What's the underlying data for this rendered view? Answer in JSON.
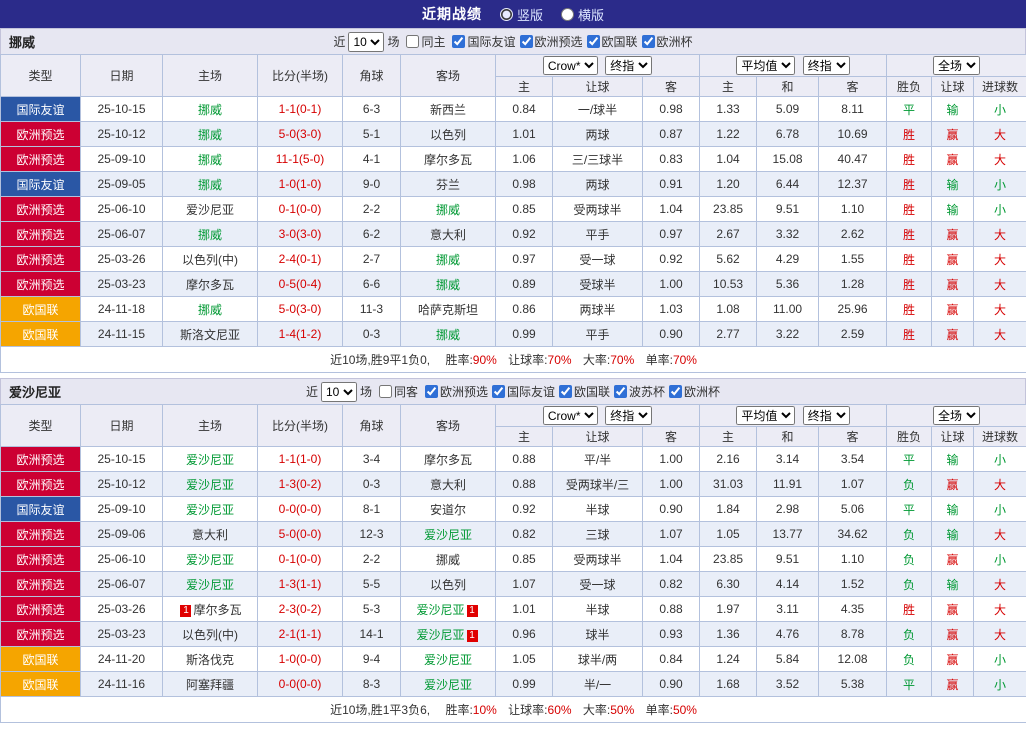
{
  "header": {
    "title": "近期战绩",
    "view_options": [
      {
        "label": "竖版",
        "selected": true
      },
      {
        "label": "横版",
        "selected": false
      }
    ]
  },
  "colors": {
    "topbar_bg": "#2b2b8a",
    "badge_friendly_blue": "#2a57a5",
    "badge_qualifier_red": "#cc0033",
    "badge_nations_orange": "#f5a500",
    "win_red": "#d60000",
    "lose_green": "#009933",
    "focus_team_green": "#009933"
  },
  "table_head": {
    "type": "类型",
    "date": "日期",
    "home": "主场",
    "score": "比分(半场)",
    "corner": "角球",
    "away": "客场",
    "odds_home": "主",
    "odds_handicap": "让球",
    "odds_away": "客",
    "avg_home": "主",
    "avg_draw": "和",
    "avg_away": "客",
    "result": "胜负",
    "handicap_result": "让球",
    "goals": "进球数",
    "dd_odds_source": "Crow*",
    "dd_final_odds": "终指",
    "dd_average": "平均值",
    "dd_final_odds2": "终指",
    "dd_scope": "全场"
  },
  "sections": [
    {
      "team": "挪威",
      "filter": {
        "near": "近",
        "count": "10",
        "games": "场",
        "same": {
          "label": "同主",
          "checked": false
        },
        "competitions": [
          {
            "label": "国际友谊",
            "checked": true
          },
          {
            "label": "欧洲预选",
            "checked": true
          },
          {
            "label": "欧国联",
            "checked": true
          },
          {
            "label": "欧洲杯",
            "checked": true
          }
        ]
      },
      "rows": [
        {
          "type": "国际友谊",
          "type_key": "friendly",
          "date": "25-10-15",
          "home": "挪威",
          "home_focus": true,
          "home_card": "",
          "score": "1-1(0-1)",
          "corner": "6-3",
          "away": "新西兰",
          "away_focus": false,
          "away_card": "",
          "odds_home": "0.84",
          "handicap": "一/球半",
          "odds_away": "0.98",
          "avg_home": "1.33",
          "avg_draw": "5.09",
          "avg_away": "8.11",
          "result": "平",
          "result_red": false,
          "handicap_result": "输",
          "handicap_red": false,
          "goals": "小",
          "goals_red": false
        },
        {
          "type": "欧洲预选",
          "type_key": "qualifier",
          "date": "25-10-12",
          "home": "挪威",
          "home_focus": true,
          "home_card": "",
          "score": "5-0(3-0)",
          "corner": "5-1",
          "away": "以色列",
          "away_focus": false,
          "away_card": "",
          "odds_home": "1.01",
          "handicap": "两球",
          "odds_away": "0.87",
          "avg_home": "1.22",
          "avg_draw": "6.78",
          "avg_away": "10.69",
          "result": "胜",
          "result_red": true,
          "handicap_result": "赢",
          "handicap_red": true,
          "goals": "大",
          "goals_red": true
        },
        {
          "type": "欧洲预选",
          "type_key": "qualifier",
          "date": "25-09-10",
          "home": "挪威",
          "home_focus": true,
          "home_card": "",
          "score": "11-1(5-0)",
          "corner": "4-1",
          "away": "摩尔多瓦",
          "away_focus": false,
          "away_card": "",
          "odds_home": "1.06",
          "handicap": "三/三球半",
          "odds_away": "0.83",
          "avg_home": "1.04",
          "avg_draw": "15.08",
          "avg_away": "40.47",
          "result": "胜",
          "result_red": true,
          "handicap_result": "赢",
          "handicap_red": true,
          "goals": "大",
          "goals_red": true
        },
        {
          "type": "国际友谊",
          "type_key": "friendly",
          "date": "25-09-05",
          "home": "挪威",
          "home_focus": true,
          "home_card": "",
          "score": "1-0(1-0)",
          "corner": "9-0",
          "away": "芬兰",
          "away_focus": false,
          "away_card": "",
          "odds_home": "0.98",
          "handicap": "两球",
          "odds_away": "0.91",
          "avg_home": "1.20",
          "avg_draw": "6.44",
          "avg_away": "12.37",
          "result": "胜",
          "result_red": true,
          "handicap_result": "输",
          "handicap_red": false,
          "goals": "小",
          "goals_red": false
        },
        {
          "type": "欧洲预选",
          "type_key": "qualifier",
          "date": "25-06-10",
          "home": "爱沙尼亚",
          "home_focus": false,
          "home_card": "",
          "score": "0-1(0-0)",
          "corner": "2-2",
          "away": "挪威",
          "away_focus": true,
          "away_card": "",
          "odds_home": "0.85",
          "handicap": "受两球半",
          "odds_away": "1.04",
          "avg_home": "23.85",
          "avg_draw": "9.51",
          "avg_away": "1.10",
          "result": "胜",
          "result_red": true,
          "handicap_result": "输",
          "handicap_red": false,
          "goals": "小",
          "goals_red": false
        },
        {
          "type": "欧洲预选",
          "type_key": "qualifier",
          "date": "25-06-07",
          "home": "挪威",
          "home_focus": true,
          "home_card": "",
          "score": "3-0(3-0)",
          "corner": "6-2",
          "away": "意大利",
          "away_focus": false,
          "away_card": "",
          "odds_home": "0.92",
          "handicap": "平手",
          "odds_away": "0.97",
          "avg_home": "2.67",
          "avg_draw": "3.32",
          "avg_away": "2.62",
          "result": "胜",
          "result_red": true,
          "handicap_result": "赢",
          "handicap_red": true,
          "goals": "大",
          "goals_red": true
        },
        {
          "type": "欧洲预选",
          "type_key": "qualifier",
          "date": "25-03-26",
          "home": "以色列(中)",
          "home_focus": false,
          "home_card": "",
          "score": "2-4(0-1)",
          "corner": "2-7",
          "away": "挪威",
          "away_focus": true,
          "away_card": "",
          "odds_home": "0.97",
          "handicap": "受一球",
          "odds_away": "0.92",
          "avg_home": "5.62",
          "avg_draw": "4.29",
          "avg_away": "1.55",
          "result": "胜",
          "result_red": true,
          "handicap_result": "赢",
          "handicap_red": true,
          "goals": "大",
          "goals_red": true
        },
        {
          "type": "欧洲预选",
          "type_key": "qualifier",
          "date": "25-03-23",
          "home": "摩尔多瓦",
          "home_focus": false,
          "home_card": "",
          "score": "0-5(0-4)",
          "corner": "6-6",
          "away": "挪威",
          "away_focus": true,
          "away_card": "",
          "odds_home": "0.89",
          "handicap": "受球半",
          "odds_away": "1.00",
          "avg_home": "10.53",
          "avg_draw": "5.36",
          "avg_away": "1.28",
          "result": "胜",
          "result_red": true,
          "handicap_result": "赢",
          "handicap_red": true,
          "goals": "大",
          "goals_red": true
        },
        {
          "type": "欧国联",
          "type_key": "nations",
          "date": "24-11-18",
          "home": "挪威",
          "home_focus": true,
          "home_card": "",
          "score": "5-0(3-0)",
          "corner": "11-3",
          "away": "哈萨克斯坦",
          "away_focus": false,
          "away_card": "",
          "odds_home": "0.86",
          "handicap": "两球半",
          "odds_away": "1.03",
          "avg_home": "1.08",
          "avg_draw": "11.00",
          "avg_away": "25.96",
          "result": "胜",
          "result_red": true,
          "handicap_result": "赢",
          "handicap_red": true,
          "goals": "大",
          "goals_red": true
        },
        {
          "type": "欧国联",
          "type_key": "nations",
          "date": "24-11-15",
          "home": "斯洛文尼亚",
          "home_focus": false,
          "home_card": "",
          "score": "1-4(1-2)",
          "corner": "0-3",
          "away": "挪威",
          "away_focus": true,
          "away_card": "",
          "odds_home": "0.99",
          "handicap": "平手",
          "odds_away": "0.90",
          "avg_home": "2.77",
          "avg_draw": "3.22",
          "avg_away": "2.59",
          "result": "胜",
          "result_red": true,
          "handicap_result": "赢",
          "handicap_red": true,
          "goals": "大",
          "goals_red": true
        }
      ],
      "summary": {
        "prefix": "近10场,胜9平1负0,",
        "stats": [
          {
            "label": "胜率:",
            "value": "90%"
          },
          {
            "label": "让球率:",
            "value": "70%"
          },
          {
            "label": "大率:",
            "value": "70%"
          },
          {
            "label": "单率:",
            "value": "70%"
          }
        ]
      }
    },
    {
      "team": "爱沙尼亚",
      "filter": {
        "near": "近",
        "count": "10",
        "games": "场",
        "same": {
          "label": "同客",
          "checked": false
        },
        "competitions": [
          {
            "label": "欧洲预选",
            "checked": true
          },
          {
            "label": "国际友谊",
            "checked": true
          },
          {
            "label": "欧国联",
            "checked": true
          },
          {
            "label": "波苏杯",
            "checked": true
          },
          {
            "label": "欧洲杯",
            "checked": true
          }
        ]
      },
      "rows": [
        {
          "type": "欧洲预选",
          "type_key": "qualifier",
          "date": "25-10-15",
          "home": "爱沙尼亚",
          "home_focus": true,
          "home_card": "",
          "score": "1-1(1-0)",
          "corner": "3-4",
          "away": "摩尔多瓦",
          "away_focus": false,
          "away_card": "",
          "odds_home": "0.88",
          "handicap": "平/半",
          "odds_away": "1.00",
          "avg_home": "2.16",
          "avg_draw": "3.14",
          "avg_away": "3.54",
          "result": "平",
          "result_red": false,
          "handicap_result": "输",
          "handicap_red": false,
          "goals": "小",
          "goals_red": false
        },
        {
          "type": "欧洲预选",
          "type_key": "qualifier",
          "date": "25-10-12",
          "home": "爱沙尼亚",
          "home_focus": true,
          "home_card": "",
          "score": "1-3(0-2)",
          "corner": "0-3",
          "away": "意大利",
          "away_focus": false,
          "away_card": "",
          "odds_home": "0.88",
          "handicap": "受两球半/三",
          "odds_away": "1.00",
          "avg_home": "31.03",
          "avg_draw": "11.91",
          "avg_away": "1.07",
          "result": "负",
          "result_red": false,
          "handicap_result": "赢",
          "handicap_red": true,
          "goals": "大",
          "goals_red": true
        },
        {
          "type": "国际友谊",
          "type_key": "friendly",
          "date": "25-09-10",
          "home": "爱沙尼亚",
          "home_focus": true,
          "home_card": "",
          "score": "0-0(0-0)",
          "corner": "8-1",
          "away": "安道尔",
          "away_focus": false,
          "away_card": "",
          "odds_home": "0.92",
          "handicap": "半球",
          "odds_away": "0.90",
          "avg_home": "1.84",
          "avg_draw": "2.98",
          "avg_away": "5.06",
          "result": "平",
          "result_red": false,
          "handicap_result": "输",
          "handicap_red": false,
          "goals": "小",
          "goals_red": false
        },
        {
          "type": "欧洲预选",
          "type_key": "qualifier",
          "date": "25-09-06",
          "home": "意大利",
          "home_focus": false,
          "home_card": "",
          "score": "5-0(0-0)",
          "corner": "12-3",
          "away": "爱沙尼亚",
          "away_focus": true,
          "away_card": "",
          "odds_home": "0.82",
          "handicap": "三球",
          "odds_away": "1.07",
          "avg_home": "1.05",
          "avg_draw": "13.77",
          "avg_away": "34.62",
          "result": "负",
          "result_red": false,
          "handicap_result": "输",
          "handicap_red": false,
          "goals": "大",
          "goals_red": true
        },
        {
          "type": "欧洲预选",
          "type_key": "qualifier",
          "date": "25-06-10",
          "home": "爱沙尼亚",
          "home_focus": true,
          "home_card": "",
          "score": "0-1(0-0)",
          "corner": "2-2",
          "away": "挪威",
          "away_focus": false,
          "away_card": "",
          "odds_home": "0.85",
          "handicap": "受两球半",
          "odds_away": "1.04",
          "avg_home": "23.85",
          "avg_draw": "9.51",
          "avg_away": "1.10",
          "result": "负",
          "result_red": false,
          "handicap_result": "赢",
          "handicap_red": true,
          "goals": "小",
          "goals_red": false
        },
        {
          "type": "欧洲预选",
          "type_key": "qualifier",
          "date": "25-06-07",
          "home": "爱沙尼亚",
          "home_focus": true,
          "home_card": "",
          "score": "1-3(1-1)",
          "corner": "5-5",
          "away": "以色列",
          "away_focus": false,
          "away_card": "",
          "odds_home": "1.07",
          "handicap": "受一球",
          "odds_away": "0.82",
          "avg_home": "6.30",
          "avg_draw": "4.14",
          "avg_away": "1.52",
          "result": "负",
          "result_red": false,
          "handicap_result": "输",
          "handicap_red": false,
          "goals": "大",
          "goals_red": true
        },
        {
          "type": "欧洲预选",
          "type_key": "qualifier",
          "date": "25-03-26",
          "home": "摩尔多瓦",
          "home_focus": false,
          "home_card": "1",
          "score": "2-3(0-2)",
          "corner": "5-3",
          "away": "爱沙尼亚",
          "away_focus": true,
          "away_card": "1",
          "odds_home": "1.01",
          "handicap": "半球",
          "odds_away": "0.88",
          "avg_home": "1.97",
          "avg_draw": "3.11",
          "avg_away": "4.35",
          "result": "胜",
          "result_red": true,
          "handicap_result": "赢",
          "handicap_red": true,
          "goals": "大",
          "goals_red": true
        },
        {
          "type": "欧洲预选",
          "type_key": "qualifier",
          "date": "25-03-23",
          "home": "以色列(中)",
          "home_focus": false,
          "home_card": "",
          "score": "2-1(1-1)",
          "corner": "14-1",
          "away": "爱沙尼亚",
          "away_focus": true,
          "away_card": "1",
          "odds_home": "0.96",
          "handicap": "球半",
          "odds_away": "0.93",
          "avg_home": "1.36",
          "avg_draw": "4.76",
          "avg_away": "8.78",
          "result": "负",
          "result_red": false,
          "handicap_result": "赢",
          "handicap_red": true,
          "goals": "大",
          "goals_red": true
        },
        {
          "type": "欧国联",
          "type_key": "nations",
          "date": "24-11-20",
          "home": "斯洛伐克",
          "home_focus": false,
          "home_card": "",
          "score": "1-0(0-0)",
          "corner": "9-4",
          "away": "爱沙尼亚",
          "away_focus": true,
          "away_card": "",
          "odds_home": "1.05",
          "handicap": "球半/两",
          "odds_away": "0.84",
          "avg_home": "1.24",
          "avg_draw": "5.84",
          "avg_away": "12.08",
          "result": "负",
          "result_red": false,
          "handicap_result": "赢",
          "handicap_red": true,
          "goals": "小",
          "goals_red": false
        },
        {
          "type": "欧国联",
          "type_key": "nations",
          "date": "24-11-16",
          "home": "阿塞拜疆",
          "home_focus": false,
          "home_card": "",
          "score": "0-0(0-0)",
          "corner": "8-3",
          "away": "爱沙尼亚",
          "away_focus": true,
          "away_card": "",
          "odds_home": "0.99",
          "handicap": "半/一",
          "odds_away": "0.90",
          "avg_home": "1.68",
          "avg_draw": "3.52",
          "avg_away": "5.38",
          "result": "平",
          "result_red": false,
          "handicap_result": "赢",
          "handicap_red": true,
          "goals": "小",
          "goals_red": false
        }
      ],
      "summary": {
        "prefix": "近10场,胜1平3负6,",
        "stats": [
          {
            "label": "胜率:",
            "value": "10%"
          },
          {
            "label": "让球率:",
            "value": "60%"
          },
          {
            "label": "大率:",
            "value": "50%"
          },
          {
            "label": "单率:",
            "value": "50%"
          }
        ]
      }
    }
  ]
}
